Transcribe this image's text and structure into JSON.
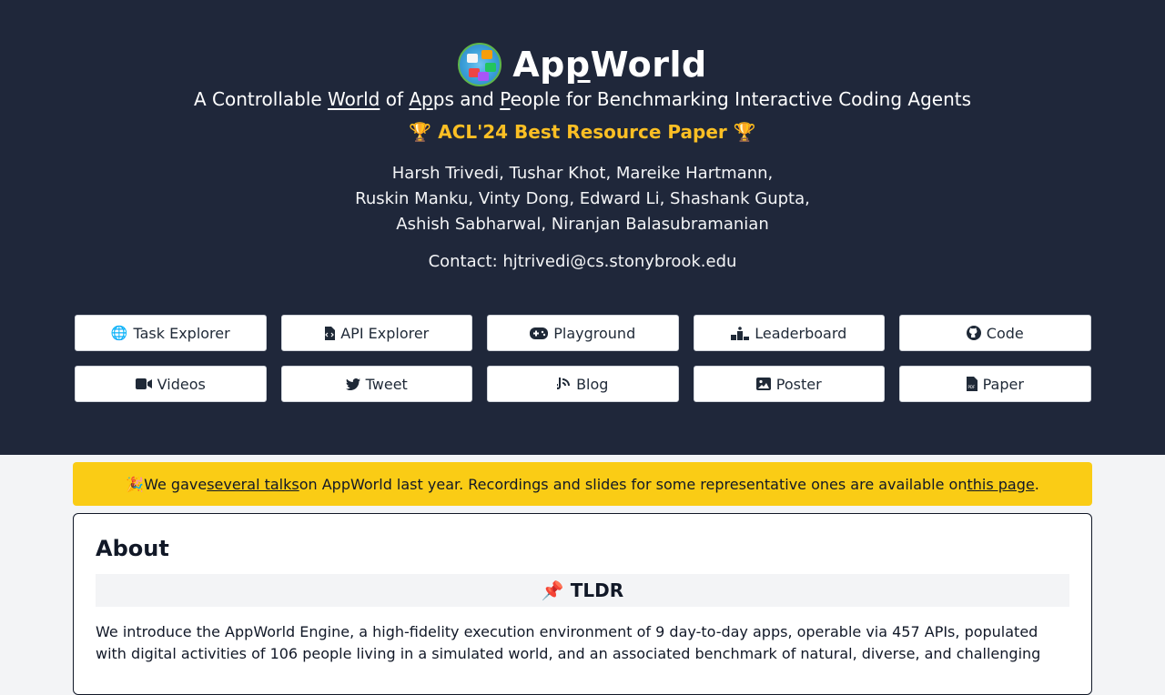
{
  "header": {
    "title_pre": "Ap",
    "title_u": "p",
    "title_post": "World",
    "subtitle": {
      "t1": "A Controllable ",
      "u1": "World",
      "t2": " of ",
      "u2": "Ap",
      "t3": "ps and ",
      "u3": "P",
      "t4": "eople for Benchmarking Interactive Coding Agents"
    },
    "award": "🏆 ACL'24 Best Resource Paper 🏆",
    "authors": [
      "Harsh Trivedi, Tushar Khot, Mareike Hartmann,",
      "Ruskin Manku, Vinty Dong, Edward Li, Shashank Gupta,",
      "Ashish Sabharwal, Niranjan Balasubramanian"
    ],
    "contact": "Contact: hjtrivedi@cs.stonybrook.edu"
  },
  "buttons": [
    {
      "label": "Task Explorer",
      "icon": "globe-icon",
      "glyph": "🌐"
    },
    {
      "label": "API Explorer",
      "icon": "file-code-icon",
      "glyph": "🗎"
    },
    {
      "label": "Playground",
      "icon": "gamepad-icon",
      "glyph": "🎮"
    },
    {
      "label": "Leaderboard",
      "icon": "podium-icon",
      "glyph": "▟"
    },
    {
      "label": "Code",
      "icon": "github-icon",
      "glyph": "●"
    },
    {
      "label": "Videos",
      "icon": "video-icon",
      "glyph": "■"
    },
    {
      "label": "Tweet",
      "icon": "twitter-icon",
      "glyph": "🐦"
    },
    {
      "label": "Blog",
      "icon": "blog-icon",
      "glyph": "◔"
    },
    {
      "label": "Poster",
      "icon": "image-icon",
      "glyph": "▣"
    },
    {
      "label": "Paper",
      "icon": "file-pdf-icon",
      "glyph": "🗎"
    }
  ],
  "banner": {
    "emoji": "🎉",
    "t1": " We gave ",
    "link1": "several talks",
    "t2": " on AppWorld last year. Recordings and slides for some representative ones are available on ",
    "link2": "this page",
    "t3": "."
  },
  "about": {
    "heading": "About",
    "tldr": "📌 TLDR",
    "text": "We introduce the AppWorld Engine, a high-fidelity execution environment of 9 day-to-day apps, operable via 457 APIs, populated with digital activities of 106 people living in a simulated world, and an associated benchmark of natural, diverse, and challenging"
  },
  "colors": {
    "hero_bg": "#1f273a",
    "award": "#fbbf24",
    "banner_bg": "#facc15"
  }
}
